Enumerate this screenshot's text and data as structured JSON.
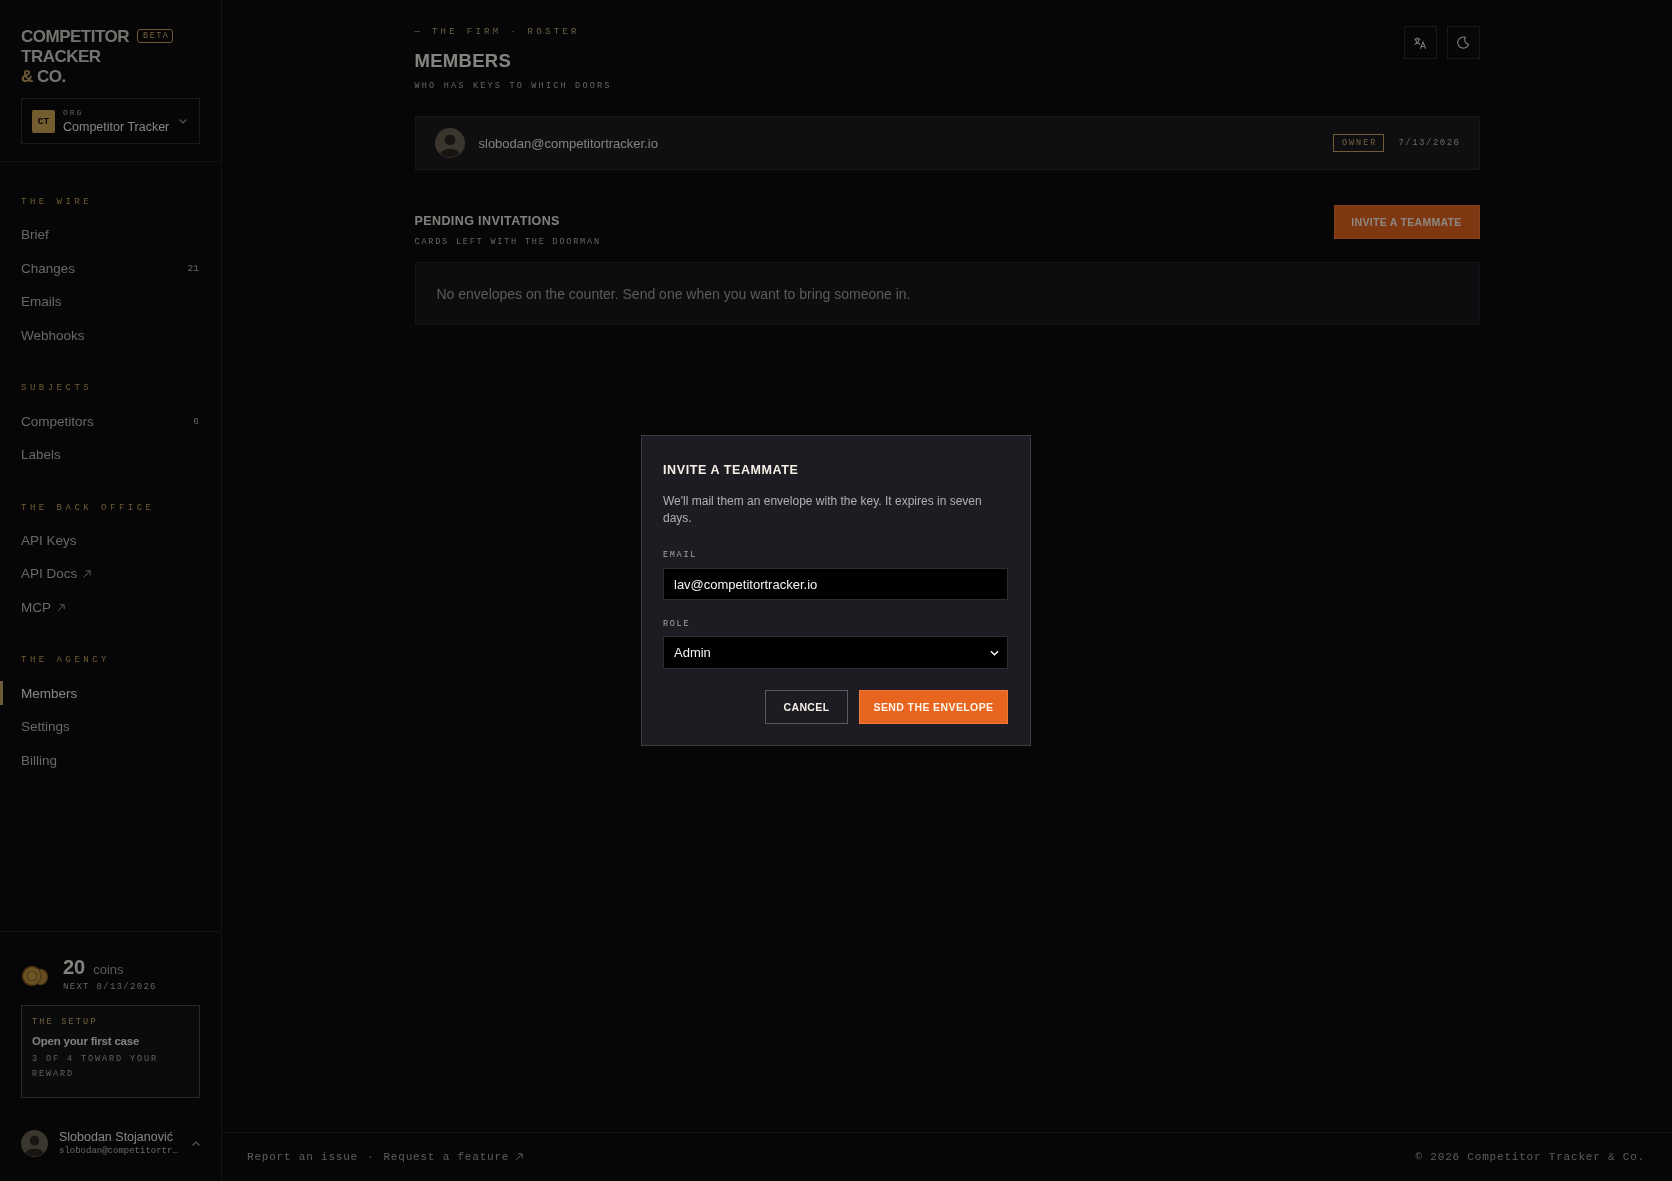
{
  "sidebar": {
    "logo": {
      "line_1": "COMPETITOR",
      "line_2": "TRACKER",
      "mark": "&",
      "line_3": "CO.",
      "badge": "BETA"
    },
    "org_switcher": {
      "initials": "CT",
      "label": "ORG",
      "name": "Competitor Tracker"
    },
    "sections": [
      {
        "title": "THE WIRE",
        "items": [
          {
            "label": "Brief",
            "selected": false,
            "external": false
          },
          {
            "label": "Changes",
            "count": "21",
            "selected": false,
            "external": false
          },
          {
            "label": "Emails",
            "selected": false,
            "external": false
          },
          {
            "label": "Webhooks",
            "selected": false,
            "external": false
          }
        ]
      },
      {
        "title": "SUBJECTS",
        "items": [
          {
            "label": "Competitors",
            "count": "6",
            "selected": false,
            "external": false
          },
          {
            "label": "Labels",
            "selected": false,
            "external": false
          }
        ]
      },
      {
        "title": "THE BACK OFFICE",
        "items": [
          {
            "label": "API Keys",
            "selected": false,
            "external": false
          },
          {
            "label": "API Docs",
            "selected": false,
            "external": true
          },
          {
            "label": "MCP",
            "selected": false,
            "external": true
          }
        ]
      },
      {
        "title": "THE AGENCY",
        "items": [
          {
            "label": "Members",
            "selected": true,
            "external": false
          },
          {
            "label": "Settings",
            "selected": false,
            "external": false
          },
          {
            "label": "Billing",
            "selected": false,
            "external": false
          }
        ]
      }
    ],
    "coins": {
      "amount": "20",
      "unit": "coins",
      "next": "NEXT 8/13/2026"
    },
    "setup_card": {
      "kicker": "THE SETUP",
      "title": "Open your first case",
      "progress": "3 OF 4 TOWARD YOUR REWARD"
    },
    "user": {
      "name": "Slobodan Stojanović",
      "email": "slobodan@competitortr…"
    }
  },
  "header": {
    "eyebrow": "— THE FIRM · ROSTER",
    "title": "MEMBERS",
    "subtitle": "WHO HAS KEYS TO WHICH DOORS"
  },
  "members": [
    {
      "email": "slobodan@competitortracker.io",
      "role": "OWNER",
      "date": "7/13/2026"
    }
  ],
  "pending": {
    "title": "PENDING INVITATIONS",
    "subtitle": "CARDS LEFT WITH THE DOORMAN",
    "button": "INVITE A TEAMMATE",
    "empty_text": "No envelopes on the counter. Send one when you want to bring someone in."
  },
  "footer": {
    "links": [
      {
        "label": "Report an issue",
        "external": false
      },
      {
        "label": "Request a feature",
        "external": true
      }
    ],
    "separator": "·",
    "copyright": "© 2026 Competitor Tracker & Co."
  },
  "modal": {
    "title": "INVITE A TEAMMATE",
    "description": "We'll mail them an envelope with the key. It expires in seven days.",
    "fields": [
      {
        "kind": "text",
        "label": "EMAIL",
        "value": "lav@competitortracker.io"
      },
      {
        "kind": "select",
        "label": "ROLE",
        "value": "Admin"
      }
    ],
    "buttons": [
      {
        "label": "CANCEL",
        "kind": "secondary"
      },
      {
        "label": "SEND THE ENVELOPE",
        "kind": "primary"
      }
    ]
  }
}
